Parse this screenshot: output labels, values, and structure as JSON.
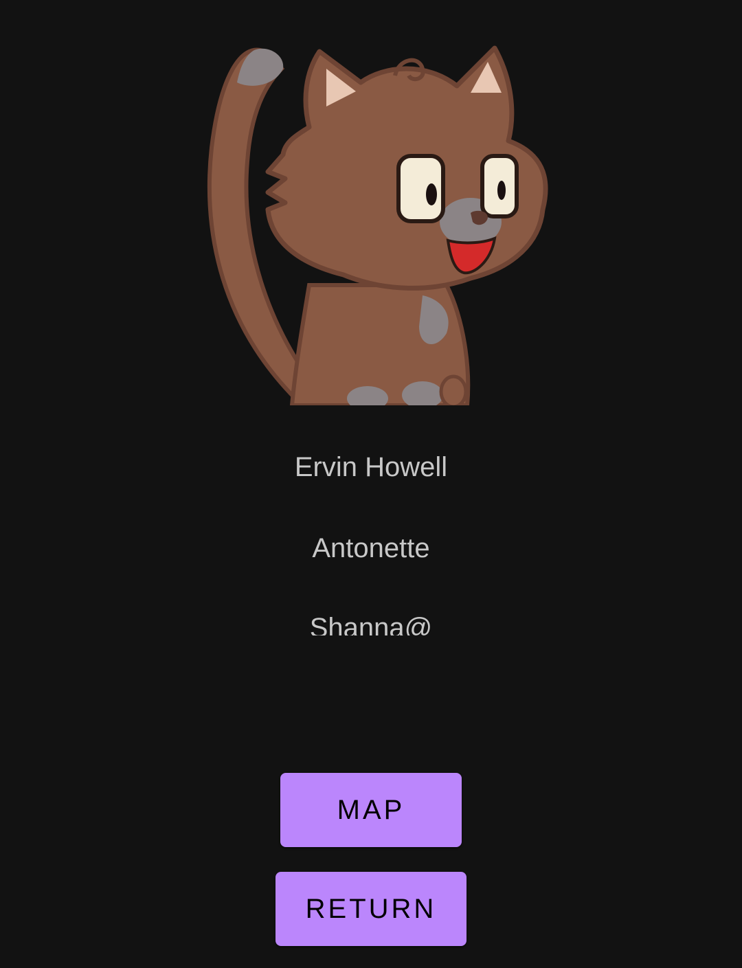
{
  "profile": {
    "avatar_icon": "cartoon-cat-icon",
    "name": "Ervin Howell",
    "username": "Antonette",
    "email": "Shanna@"
  },
  "actions": {
    "map_label": "MAP",
    "return_label": "RETURN"
  },
  "colors": {
    "background": "#121212",
    "text": "#c8c8c8",
    "button": "#bb86fc",
    "button_text": "#000000",
    "cat_fur": "#8a5a44",
    "cat_outline": "#6e4434"
  }
}
